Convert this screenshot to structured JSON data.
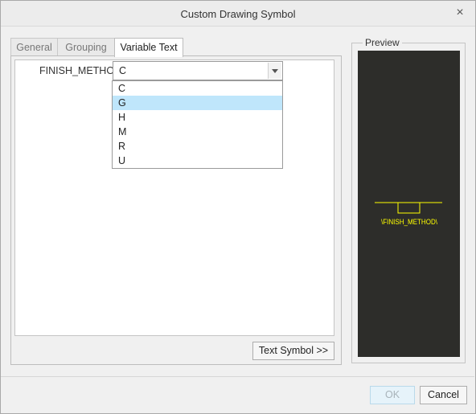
{
  "window": {
    "title": "Custom Drawing Symbol",
    "close_glyph": "×"
  },
  "tabs": [
    {
      "label": "General",
      "active": false
    },
    {
      "label": "Grouping",
      "active": false
    },
    {
      "label": "Variable Text",
      "active": true
    }
  ],
  "variable_text": {
    "field_label": "FINISH_METHOD",
    "combo_value": "C",
    "dropdown_options": [
      "C",
      "G",
      "H",
      "M",
      "R",
      "U"
    ],
    "highlighted_option": "G",
    "text_symbol_button": "Text Symbol >>"
  },
  "preview": {
    "label": "Preview",
    "symbol_text": "\\FINISH_METHOD\\",
    "background_color": "#2d2d2a",
    "symbol_color": "#ffff00"
  },
  "footer": {
    "ok_label": "OK",
    "ok_enabled": false,
    "cancel_label": "Cancel"
  }
}
